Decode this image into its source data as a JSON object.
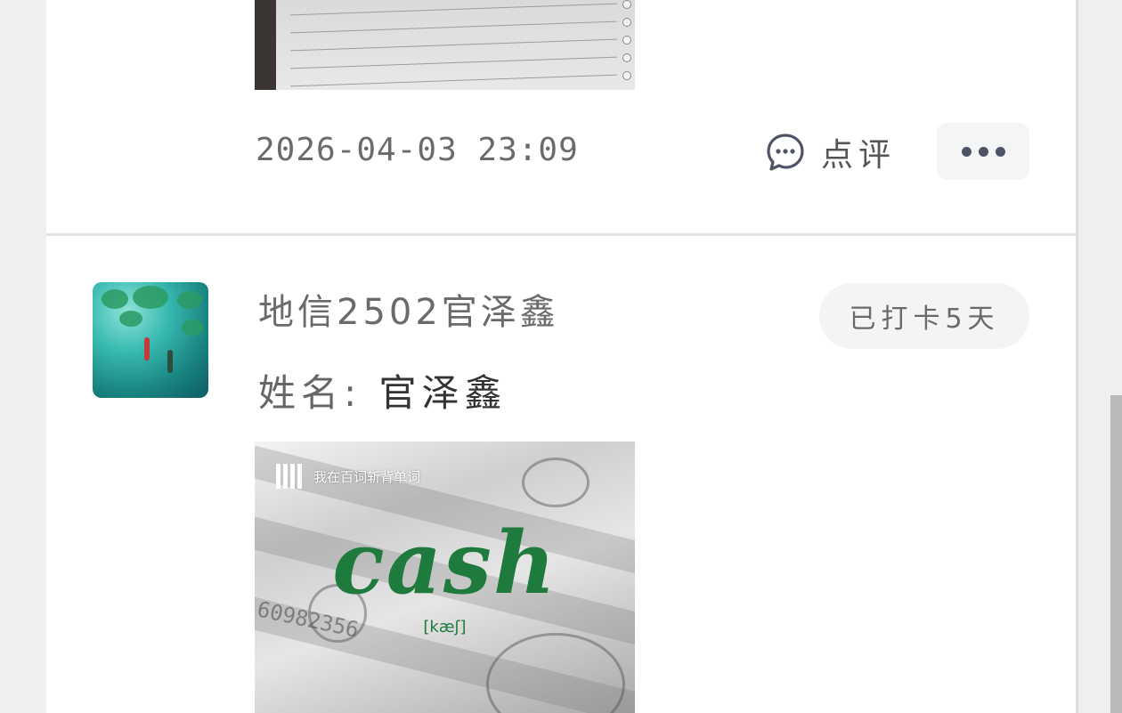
{
  "previous_post": {
    "timestamp": "2026-04-03 23:09",
    "comment_label": "点评"
  },
  "post": {
    "username": "地信2502官泽鑫",
    "checkin_badge": "已打卡5天",
    "name_key": "姓名:",
    "name_value": "官泽鑫",
    "image": {
      "brand_text": "我在百词斩背单词",
      "word": "cash",
      "phonetic": "[kæʃ]",
      "serial": "60982356"
    }
  },
  "icons": {
    "comment": "chat-bubble-icon",
    "more": "more-dots-icon"
  },
  "colors": {
    "word_green": "#1f7a3e",
    "badge_bg": "#f4f4f4",
    "more_dots": "#4e5366"
  }
}
